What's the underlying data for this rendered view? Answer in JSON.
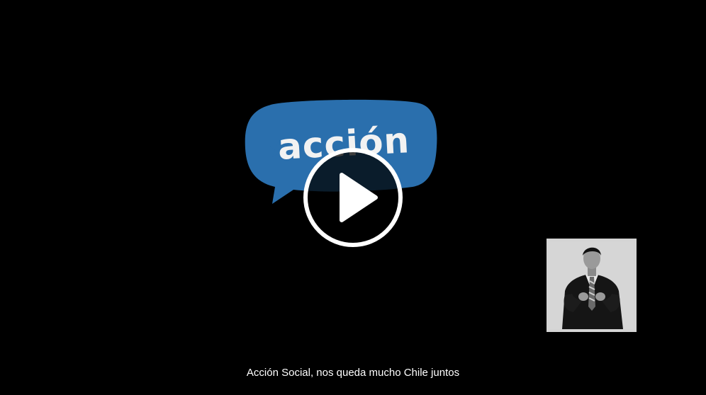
{
  "logo": {
    "text": "acción",
    "bubble_color": "#2a6fad"
  },
  "player": {
    "play_icon": "play-icon"
  },
  "interpreter": {
    "icon": "sign-language-interpreter-icon"
  },
  "caption": {
    "text": "Acción Social, nos queda mucho Chile juntos"
  }
}
